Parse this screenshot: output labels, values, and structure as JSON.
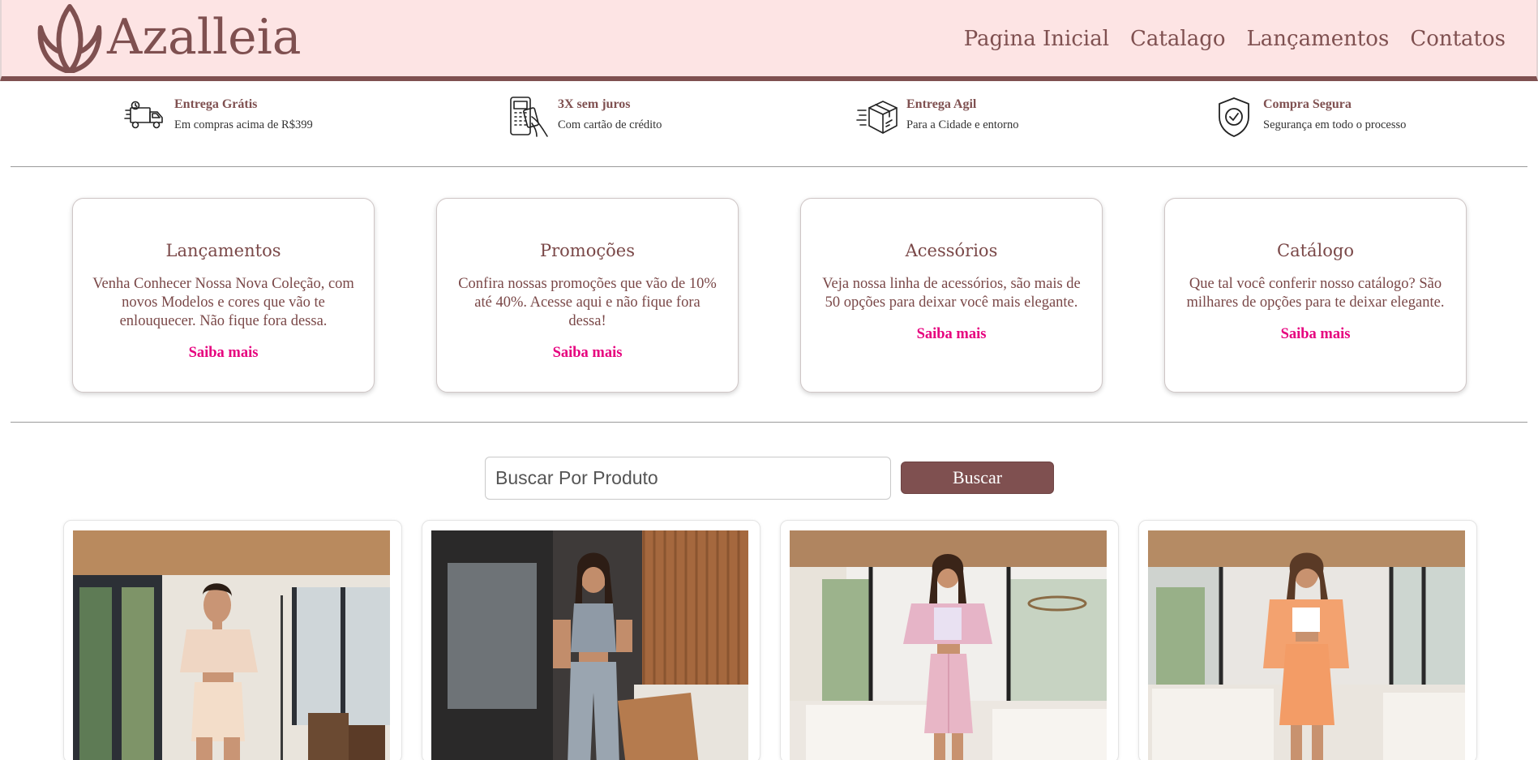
{
  "brand": {
    "name": "Azalleia",
    "logo_icon": "lotus-icon"
  },
  "nav": [
    {
      "label": "Pagina Inicial"
    },
    {
      "label": "Catalago"
    },
    {
      "label": "Lançamentos"
    },
    {
      "label": "Contatos"
    }
  ],
  "benefits": [
    {
      "icon": "delivery-truck-icon",
      "title": "Entrega Grátis",
      "subtitle": "Em compras acima de R$399"
    },
    {
      "icon": "card-payment-icon",
      "title": "3X sem juros",
      "subtitle": "Com cartão de crédito"
    },
    {
      "icon": "fast-box-icon",
      "title": "Entrega Agil",
      "subtitle": "Para a Cidade e entorno"
    },
    {
      "icon": "shield-check-icon",
      "title": "Compra Segura",
      "subtitle": "Segurança em todo o processo"
    }
  ],
  "cards": [
    {
      "title": "Lançamentos",
      "text": "Venha Conhecer Nossa Nova Coleção, com novos Modelos e cores que vão te enlouquecer. Não fique fora dessa.",
      "link": "Saiba mais"
    },
    {
      "title": "Promoções",
      "text": "Confira nossas promoções que vão de 10% até 40%. Acesse aqui e não fique fora dessa!",
      "link": "Saiba mais"
    },
    {
      "title": "Acessórios",
      "text": "Veja nossa linha de acessórios, são mais de 50 opções para deixar você mais elegante.",
      "link": "Saiba mais"
    },
    {
      "title": "Catálogo",
      "text": "Que tal você conferir nosso catálogo? São milhares de opções para te deixar elegante.",
      "link": "Saiba mais"
    }
  ],
  "search": {
    "placeholder": "Buscar Por Produto",
    "value": "",
    "button": "Buscar"
  },
  "colors": {
    "brand": "#7f5050",
    "header_bg": "#fde4e4",
    "accent_link": "#e6007e"
  },
  "products": [
    {
      "image": "model-beige-outfit"
    },
    {
      "image": "model-grey-outfit"
    },
    {
      "image": "model-pink-outfit"
    },
    {
      "image": "model-orange-outfit"
    }
  ]
}
